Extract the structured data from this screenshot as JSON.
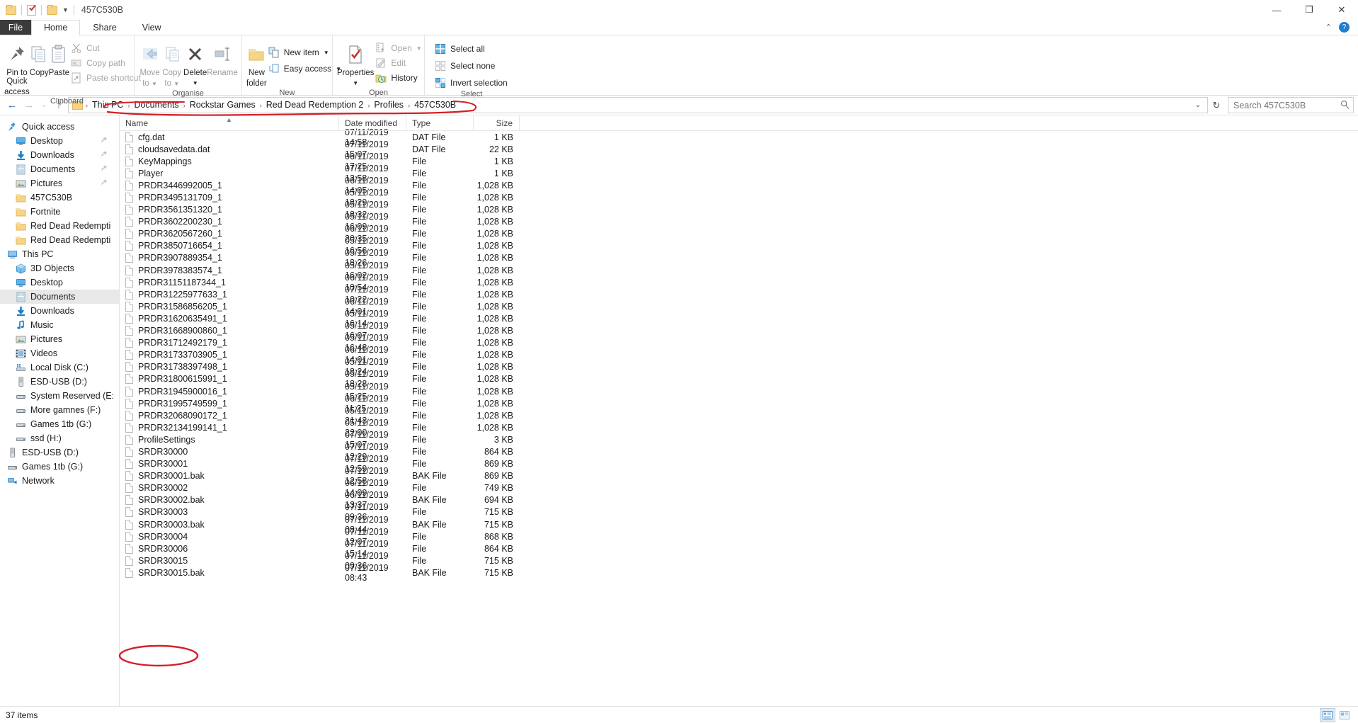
{
  "window": {
    "title": "457C530B",
    "quick_access_toolbar": [
      "folder-icon",
      "properties-icon",
      "new-folder-icon",
      "customise-caret"
    ],
    "controls": {
      "minimize": "—",
      "maximize": "❐",
      "close": "✕",
      "ribbon_collapse": "⌃",
      "help": "?"
    }
  },
  "tabs": [
    {
      "label": "File",
      "active": false
    },
    {
      "label": "Home",
      "active": true
    },
    {
      "label": "Share",
      "active": false
    },
    {
      "label": "View",
      "active": false
    }
  ],
  "ribbon": {
    "groups": [
      {
        "label": "Clipboard",
        "big": [
          {
            "label_line1": "Pin to Quick",
            "label_line2": "access",
            "icon": "pin-icon"
          },
          {
            "label_line1": "Copy",
            "label_line2": "",
            "icon": "copy-icon"
          },
          {
            "label_line1": "Paste",
            "label_line2": "",
            "icon": "paste-icon"
          }
        ],
        "small": [
          {
            "label": "Cut",
            "icon": "scissors-icon",
            "disabled": true
          },
          {
            "label": "Copy path",
            "icon": "copy-path-icon",
            "disabled": true
          },
          {
            "label": "Paste shortcut",
            "icon": "paste-shortcut-icon",
            "disabled": true
          }
        ]
      },
      {
        "label": "Organise",
        "big": [
          {
            "label_line1": "Move",
            "label_line2": "to",
            "icon": "move-to-icon",
            "caret": true,
            "disabled": true
          },
          {
            "label_line1": "Copy",
            "label_line2": "to",
            "icon": "copy-to-icon",
            "caret": true,
            "disabled": true
          },
          {
            "label_line1": "Delete",
            "label_line2": "",
            "icon": "delete-icon",
            "caret": true
          },
          {
            "label_line1": "Rename",
            "label_line2": "",
            "icon": "rename-icon",
            "disabled": true
          }
        ],
        "small": []
      },
      {
        "label": "New",
        "big": [
          {
            "label_line1": "New",
            "label_line2": "folder",
            "icon": "new-folder-icon"
          }
        ],
        "small": [
          {
            "label": "New item",
            "icon": "new-item-icon",
            "caret": true
          },
          {
            "label": "Easy access",
            "icon": "easy-access-icon",
            "caret": true
          }
        ]
      },
      {
        "label": "Open",
        "big": [
          {
            "label_line1": "Properties",
            "label_line2": "",
            "icon": "properties-icon",
            "caret": true
          }
        ],
        "small": [
          {
            "label": "Open",
            "icon": "open-icon",
            "caret": true,
            "disabled": true
          },
          {
            "label": "Edit",
            "icon": "edit-icon",
            "disabled": true
          },
          {
            "label": "History",
            "icon": "history-icon"
          }
        ]
      },
      {
        "label": "Select",
        "big": [],
        "small": [
          {
            "label": "Select all",
            "icon": "select-all-icon"
          },
          {
            "label": "Select none",
            "icon": "select-none-icon"
          },
          {
            "label": "Invert selection",
            "icon": "invert-selection-icon"
          }
        ]
      }
    ]
  },
  "address": {
    "back": "←",
    "forward": "→",
    "recent_caret": "⌄",
    "up": "↑",
    "breadcrumbs": [
      "This PC",
      "Documents",
      "Rockstar Games",
      "Red Dead Redemption 2",
      "Profiles",
      "457C530B"
    ],
    "separator": "›",
    "dropdown_caret": "⌄",
    "refresh": "↻"
  },
  "search": {
    "placeholder": "Search 457C530B",
    "value": "",
    "icon": "search-icon"
  },
  "navigation_pane": {
    "items": [
      {
        "label": "Quick access",
        "icon": "quick-access-star-icon",
        "indent": 0,
        "selected": false,
        "pinned": false
      },
      {
        "label": "Desktop",
        "icon": "desktop-icon",
        "indent": 1,
        "selected": false,
        "pinned": true
      },
      {
        "label": "Downloads",
        "icon": "downloads-icon",
        "indent": 1,
        "selected": false,
        "pinned": true
      },
      {
        "label": "Documents",
        "icon": "documents-icon",
        "indent": 1,
        "selected": false,
        "pinned": true
      },
      {
        "label": "Pictures",
        "icon": "pictures-icon",
        "indent": 1,
        "selected": false,
        "pinned": true
      },
      {
        "label": "457C530B",
        "icon": "folder-icon",
        "indent": 1,
        "selected": false,
        "pinned": false
      },
      {
        "label": "Fortnite",
        "icon": "folder-icon",
        "indent": 1,
        "selected": false,
        "pinned": false
      },
      {
        "label": "Red Dead Redempti",
        "icon": "folder-icon",
        "indent": 1,
        "selected": false,
        "pinned": false
      },
      {
        "label": "Red Dead Redempti",
        "icon": "folder-icon",
        "indent": 1,
        "selected": false,
        "pinned": false
      },
      {
        "label": "This PC",
        "icon": "this-pc-icon",
        "indent": 0,
        "selected": false,
        "pinned": false
      },
      {
        "label": "3D Objects",
        "icon": "3d-objects-icon",
        "indent": 1,
        "selected": false,
        "pinned": false
      },
      {
        "label": "Desktop",
        "icon": "desktop-icon",
        "indent": 1,
        "selected": false,
        "pinned": false
      },
      {
        "label": "Documents",
        "icon": "documents-icon",
        "indent": 1,
        "selected": true,
        "pinned": false
      },
      {
        "label": "Downloads",
        "icon": "downloads-icon",
        "indent": 1,
        "selected": false,
        "pinned": false
      },
      {
        "label": "Music",
        "icon": "music-icon",
        "indent": 1,
        "selected": false,
        "pinned": false
      },
      {
        "label": "Pictures",
        "icon": "pictures-icon",
        "indent": 1,
        "selected": false,
        "pinned": false
      },
      {
        "label": "Videos",
        "icon": "videos-icon",
        "indent": 1,
        "selected": false,
        "pinned": false
      },
      {
        "label": "Local Disk (C:)",
        "icon": "local-disk-icon",
        "indent": 1,
        "selected": false,
        "pinned": false
      },
      {
        "label": "ESD-USB (D:)",
        "icon": "usb-drive-icon",
        "indent": 1,
        "selected": false,
        "pinned": false
      },
      {
        "label": "System Reserved (E:",
        "icon": "drive-icon",
        "indent": 1,
        "selected": false,
        "pinned": false
      },
      {
        "label": "More gamnes (F:)",
        "icon": "drive-icon",
        "indent": 1,
        "selected": false,
        "pinned": false
      },
      {
        "label": "Games 1tb (G:)",
        "icon": "drive-icon",
        "indent": 1,
        "selected": false,
        "pinned": false
      },
      {
        "label": "ssd (H:)",
        "icon": "drive-icon",
        "indent": 1,
        "selected": false,
        "pinned": false
      },
      {
        "label": "ESD-USB (D:)",
        "icon": "usb-drive-icon",
        "indent": 0,
        "selected": false,
        "pinned": false
      },
      {
        "label": "Games 1tb (G:)",
        "icon": "drive-icon",
        "indent": 0,
        "selected": false,
        "pinned": false
      },
      {
        "label": "Network",
        "icon": "network-icon",
        "indent": 0,
        "selected": false,
        "pinned": false
      }
    ]
  },
  "file_list": {
    "columns": [
      {
        "label": "Name",
        "sorted": true,
        "sort_direction": "asc"
      },
      {
        "label": "Date modified",
        "sorted": false
      },
      {
        "label": "Type",
        "sorted": false
      },
      {
        "label": "Size",
        "sorted": false
      }
    ],
    "rows": [
      {
        "name": "cfg.dat",
        "date": "07/11/2019 14:58",
        "type": "DAT File",
        "size": "1 KB"
      },
      {
        "name": "cloudsavedata.dat",
        "date": "07/11/2019 15:07",
        "type": "DAT File",
        "size": "22 KB"
      },
      {
        "name": "KeyMappings",
        "date": "06/11/2019 17:25",
        "type": "File",
        "size": "1 KB"
      },
      {
        "name": "Player",
        "date": "07/11/2019 13:58",
        "type": "File",
        "size": "1 KB"
      },
      {
        "name": "PRDR3446992005_1",
        "date": "06/11/2019 14:05",
        "type": "File",
        "size": "1,028 KB"
      },
      {
        "name": "PRDR3495131709_1",
        "date": "05/11/2019 18:29",
        "type": "File",
        "size": "1,028 KB"
      },
      {
        "name": "PRDR3561351320_1",
        "date": "05/11/2019 18:32",
        "type": "File",
        "size": "1,028 KB"
      },
      {
        "name": "PRDR3602200230_1",
        "date": "05/11/2019 16:09",
        "type": "File",
        "size": "1,028 KB"
      },
      {
        "name": "PRDR3620567260_1",
        "date": "06/11/2019 20:35",
        "type": "File",
        "size": "1,028 KB"
      },
      {
        "name": "PRDR3850716654_1",
        "date": "05/11/2019 16:56",
        "type": "File",
        "size": "1,028 KB"
      },
      {
        "name": "PRDR3907889354_1",
        "date": "05/11/2019 18:26",
        "type": "File",
        "size": "1,028 KB"
      },
      {
        "name": "PRDR3978383574_1",
        "date": "05/11/2019 16:02",
        "type": "File",
        "size": "1,028 KB"
      },
      {
        "name": "PRDR31151187344_1",
        "date": "06/11/2019 10:54",
        "type": "File",
        "size": "1,028 KB"
      },
      {
        "name": "PRDR31225977633_1",
        "date": "07/11/2019 10:22",
        "type": "File",
        "size": "1,028 KB"
      },
      {
        "name": "PRDR31586856205_1",
        "date": "06/11/2019 14:01",
        "type": "File",
        "size": "1,028 KB"
      },
      {
        "name": "PRDR31620635491_1",
        "date": "05/11/2019 16:14",
        "type": "File",
        "size": "1,028 KB"
      },
      {
        "name": "PRDR31668900860_1",
        "date": "05/11/2019 16:07",
        "type": "File",
        "size": "1,028 KB"
      },
      {
        "name": "PRDR31712492179_1",
        "date": "05/11/2019 16:48",
        "type": "File",
        "size": "1,028 KB"
      },
      {
        "name": "PRDR31733703905_1",
        "date": "06/11/2019 14:01",
        "type": "File",
        "size": "1,028 KB"
      },
      {
        "name": "PRDR31738397498_1",
        "date": "05/11/2019 18:24",
        "type": "File",
        "size": "1,028 KB"
      },
      {
        "name": "PRDR31800615991_1",
        "date": "05/11/2019 18:28",
        "type": "File",
        "size": "1,028 KB"
      },
      {
        "name": "PRDR31945900016_1",
        "date": "05/11/2019 15:25",
        "type": "File",
        "size": "1,028 KB"
      },
      {
        "name": "PRDR31995749599_1",
        "date": "06/11/2019 11:25",
        "type": "File",
        "size": "1,028 KB"
      },
      {
        "name": "PRDR32068090172_1",
        "date": "05/11/2019 21:43",
        "type": "File",
        "size": "1,028 KB"
      },
      {
        "name": "PRDR32134199141_1",
        "date": "05/11/2019 22:00",
        "type": "File",
        "size": "1,028 KB"
      },
      {
        "name": "ProfileSettings",
        "date": "07/11/2019 15:07",
        "type": "File",
        "size": "3 KB"
      },
      {
        "name": "SRDR30000",
        "date": "07/11/2019 12:29",
        "type": "File",
        "size": "864 KB"
      },
      {
        "name": "SRDR30001",
        "date": "07/11/2019 12:59",
        "type": "File",
        "size": "869 KB"
      },
      {
        "name": "SRDR30001.bak",
        "date": "07/11/2019 12:58",
        "type": "BAK File",
        "size": "869 KB"
      },
      {
        "name": "SRDR30002",
        "date": "06/11/2019 14:09",
        "type": "File",
        "size": "749 KB"
      },
      {
        "name": "SRDR30002.bak",
        "date": "06/11/2019 13:37",
        "type": "BAK File",
        "size": "694 KB"
      },
      {
        "name": "SRDR30003",
        "date": "07/11/2019 09:36",
        "type": "File",
        "size": "715 KB"
      },
      {
        "name": "SRDR30003.bak",
        "date": "07/11/2019 08:44",
        "type": "BAK File",
        "size": "715 KB"
      },
      {
        "name": "SRDR30004",
        "date": "07/11/2019 12:07",
        "type": "File",
        "size": "868 KB"
      },
      {
        "name": "SRDR30006",
        "date": "07/11/2019 15:14",
        "type": "File",
        "size": "864 KB"
      },
      {
        "name": "SRDR30015",
        "date": "07/11/2019 09:36",
        "type": "File",
        "size": "715 KB"
      },
      {
        "name": "SRDR30015.bak",
        "date": "07/11/2019 08:43",
        "type": "BAK File",
        "size": "715 KB"
      }
    ]
  },
  "status_bar": {
    "item_count": "37 items",
    "view_details": "details-view-icon",
    "view_large": "large-icons-view-icon"
  },
  "annotations": {
    "colour": "#d61f26",
    "marks": [
      {
        "target": "breadcrumb-path",
        "shape": "ellipse"
      },
      {
        "target": "file-row-SRDR30006",
        "shape": "ellipse"
      }
    ]
  }
}
